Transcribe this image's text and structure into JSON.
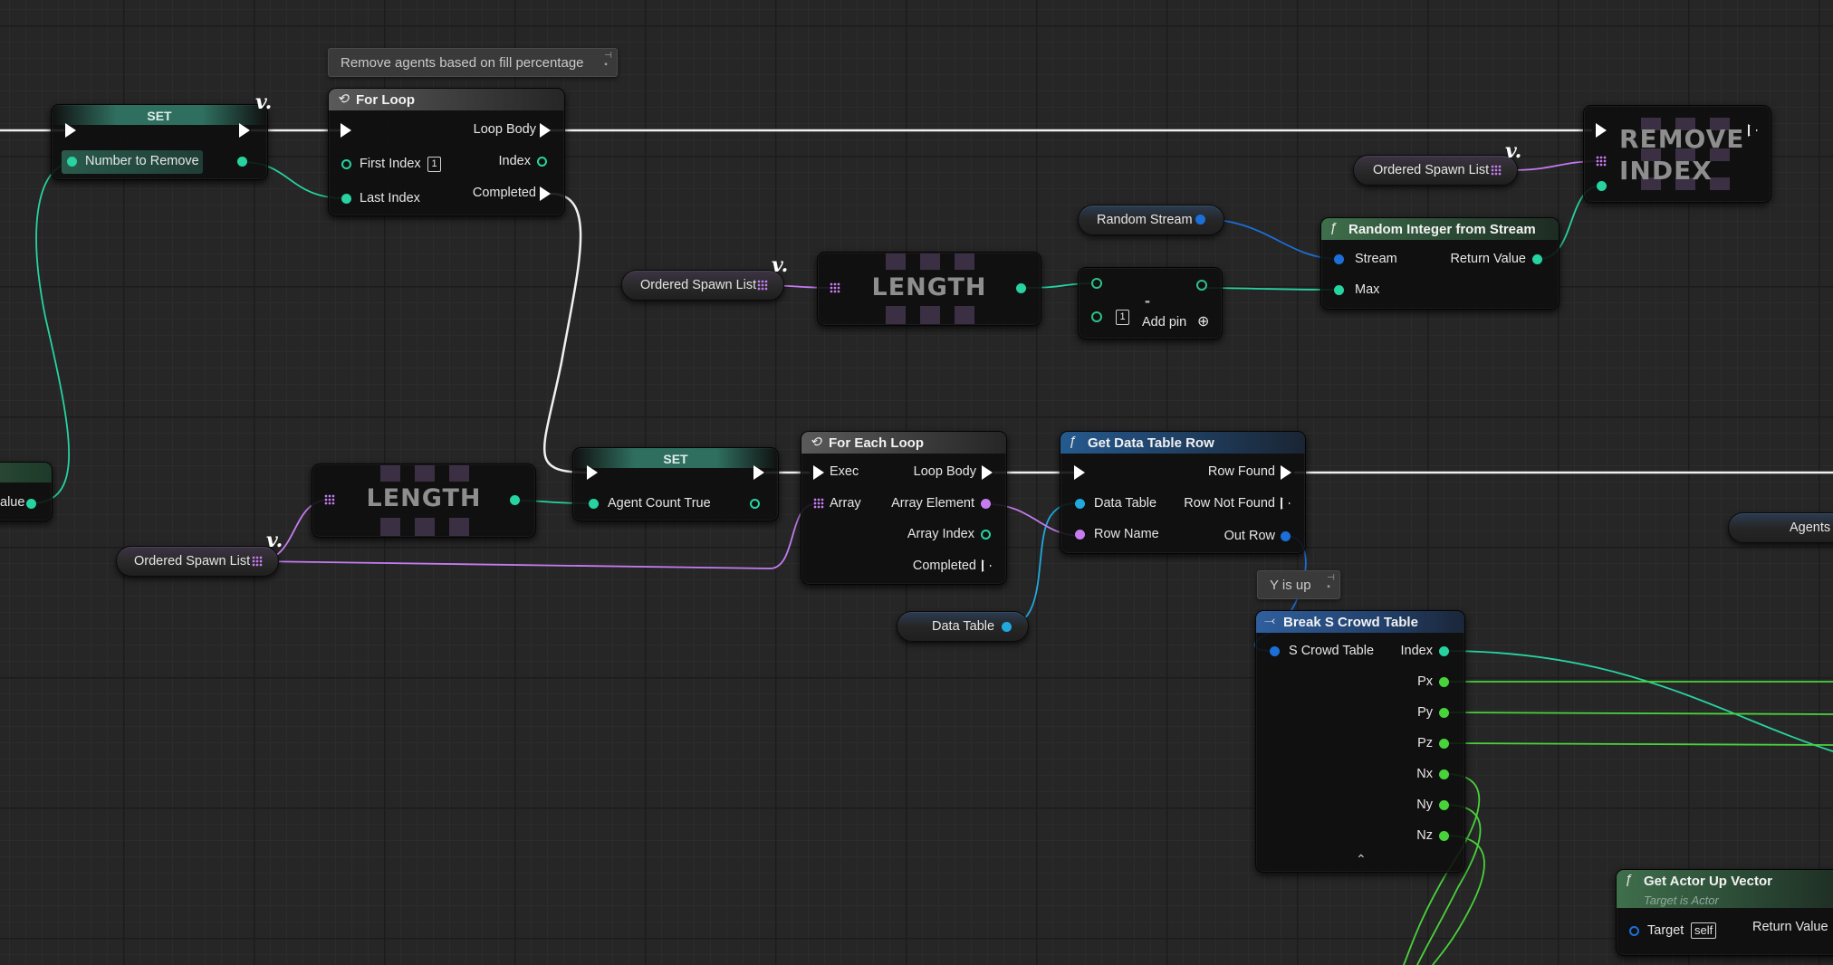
{
  "comments": {
    "fill_percentage": "Remove agents based on fill percentage",
    "y_is_up": "Y is up"
  },
  "set_top": {
    "title": "SET",
    "pin": "Number to Remove"
  },
  "for_loop": {
    "title": "For Loop",
    "first_index": "First Index",
    "first_index_value": "1",
    "last_index": "Last Index",
    "loop_body": "Loop Body",
    "index": "Index",
    "completed": "Completed"
  },
  "remove_index": {
    "line1": "REMOVE",
    "line2": "INDEX"
  },
  "var_ordered_top": {
    "label": "Ordered Spawn List"
  },
  "var_ordered_mid": {
    "label": "Ordered Spawn List"
  },
  "var_ordered_low": {
    "label": "Ordered Spawn List"
  },
  "var_random_stream": {
    "label": "Random Stream"
  },
  "var_data_table": {
    "label": "Data Table"
  },
  "var_agents": {
    "label": "Agents"
  },
  "var_tag": "v.",
  "random_int": {
    "title": "Random Integer from Stream",
    "stream": "Stream",
    "max": "Max",
    "return_value": "Return Value"
  },
  "length_top": {
    "title": "LENGTH"
  },
  "length_low": {
    "title": "LENGTH"
  },
  "subtract": {
    "symbol": "-",
    "box_value": "1",
    "add_pin": "Add pin"
  },
  "set_mid": {
    "title": "SET",
    "pin": "Agent Count True"
  },
  "for_each": {
    "title": "For Each Loop",
    "exec": "Exec",
    "array": "Array",
    "loop_body": "Loop Body",
    "array_element": "Array Element",
    "array_index": "Array Index",
    "completed": "Completed"
  },
  "get_row": {
    "title": "Get Data Table Row",
    "data_table": "Data Table",
    "row_name": "Row Name",
    "row_found": "Row Found",
    "row_not_found": "Row Not Found",
    "out_row": "Out Row"
  },
  "break_table": {
    "title": "Break S Crowd Table",
    "input": "S Crowd Table",
    "outputs": [
      "Index",
      "Px",
      "Py",
      "Pz",
      "Nx",
      "Ny",
      "Nz"
    ]
  },
  "up_vector": {
    "title": "Get Actor Up Vector",
    "subtitle": "Target is Actor",
    "target": "Target",
    "self": "self",
    "return_value": "Return Value"
  },
  "left_partial": {
    "label": "alue"
  },
  "colors": {
    "exec": "#ffffff",
    "int": "#27d3a0",
    "struct": "#1c6fd8",
    "name": "#c57cf0",
    "float": "#49d33b",
    "array": "#c57cf0"
  }
}
